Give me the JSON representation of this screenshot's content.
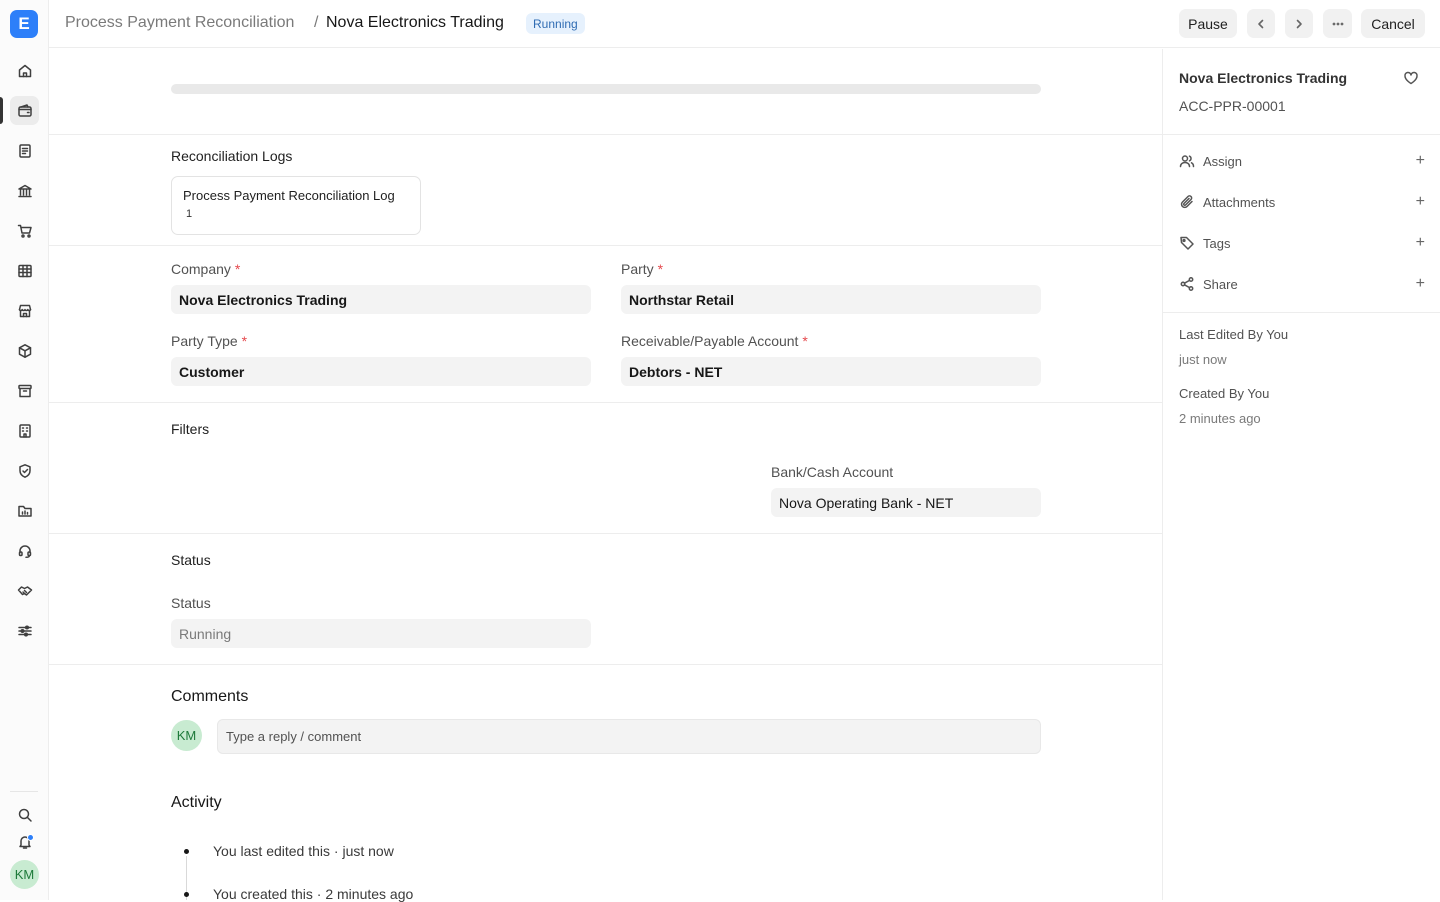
{
  "app": {
    "logo_letter": "E"
  },
  "sidebar": {
    "items": [
      {
        "icon": "home-icon"
      },
      {
        "icon": "wallet-icon"
      },
      {
        "icon": "document-icon"
      },
      {
        "icon": "bank-icon"
      },
      {
        "icon": "cart-icon"
      },
      {
        "icon": "table-icon"
      },
      {
        "icon": "store-icon"
      },
      {
        "icon": "box-icon"
      },
      {
        "icon": "archive-icon"
      },
      {
        "icon": "building-icon"
      },
      {
        "icon": "shield-icon"
      },
      {
        "icon": "folder-chart-icon"
      },
      {
        "icon": "headset-icon"
      },
      {
        "icon": "handshake-icon"
      },
      {
        "icon": "sliders-icon"
      }
    ],
    "active_index": 1,
    "user_initials": "KM"
  },
  "header": {
    "breadcrumb_parent": "Process Payment Reconciliation",
    "breadcrumb_separator": "/",
    "title": "Nova Electronics Trading",
    "status_badge": "Running",
    "pause_label": "Pause",
    "cancel_label": "Cancel"
  },
  "form": {
    "progress": 0,
    "logs_title": "Reconciliation Logs",
    "log_card": {
      "title": "Process Payment Reconciliation Log",
      "count": "1"
    },
    "company_label": "Company",
    "company_value": "Nova Electronics Trading",
    "party_label": "Party",
    "party_value": "Northstar Retail",
    "party_type_label": "Party Type",
    "party_type_value": "Customer",
    "account_label": "Receivable/Payable Account",
    "account_value": "Debtors - NET",
    "filters_title": "Filters",
    "bank_label": "Bank/Cash Account",
    "bank_value": "Nova Operating Bank - NET",
    "status_section_title": "Status",
    "status_label": "Status",
    "status_value": "Running",
    "required_mark": "*"
  },
  "comments": {
    "title": "Comments",
    "avatar_initials": "KM",
    "placeholder": "Type a reply / comment"
  },
  "activity": {
    "title": "Activity",
    "items": [
      "You last edited this · just now",
      "You created this · 2 minutes ago"
    ]
  },
  "right_panel": {
    "title": "Nova Electronics Trading",
    "doc_id": "ACC-PPR-00001",
    "assign_label": "Assign",
    "attachments_label": "Attachments",
    "tags_label": "Tags",
    "share_label": "Share",
    "plus": "+",
    "last_edited_label": "Last Edited By You",
    "last_edited_time": "just now",
    "created_label": "Created By You",
    "created_time": "2 minutes ago"
  }
}
